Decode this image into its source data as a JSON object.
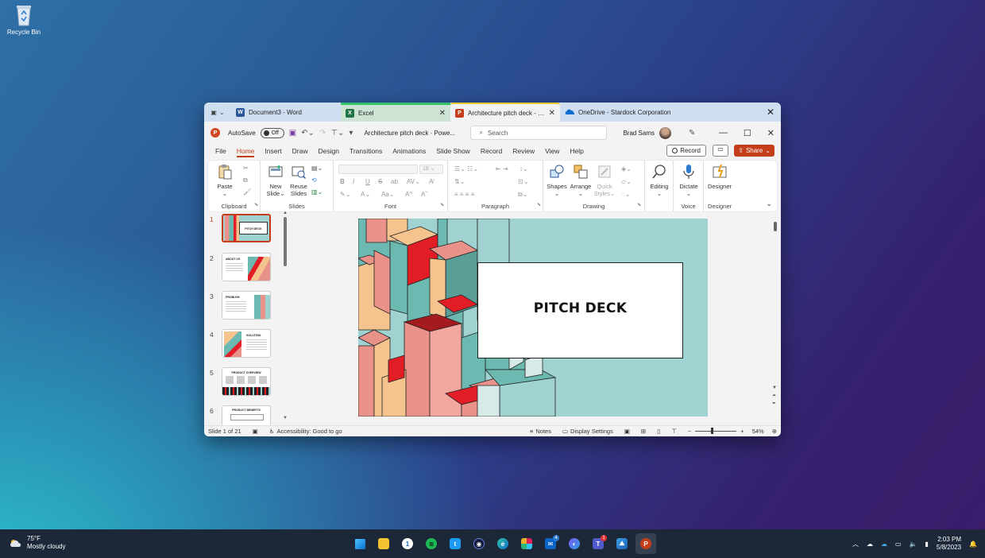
{
  "desktop": {
    "recycle_bin_label": "Recycle Bin"
  },
  "window": {
    "tabs": [
      {
        "label": "Document3 - Word",
        "app": "Word",
        "color": "#2b579a"
      },
      {
        "label": "Excel",
        "app": "Excel",
        "color": "#217346"
      },
      {
        "label": "Architecture pitch deck - P...",
        "app": "PowerPoint",
        "color": "#c43e1c"
      },
      {
        "label": "OneDrive - Stardock Corporation",
        "app": "OneDrive",
        "color": "#0078d4"
      }
    ],
    "title_bar": {
      "autosave_label": "AutoSave",
      "autosave_state": "Off",
      "doc_title": "Architecture pitch deck  ·  Powe...",
      "search_placeholder": "Search",
      "user_name": "Brad Sams"
    },
    "menu": [
      "File",
      "Home",
      "Insert",
      "Draw",
      "Design",
      "Transitions",
      "Animations",
      "Slide Show",
      "Record",
      "Review",
      "View",
      "Help"
    ],
    "active_menu": "Home",
    "record_label": "Record",
    "share_label": "Share",
    "ribbon": {
      "groups": {
        "clipboard": "Clipboard",
        "slides": "Slides",
        "font": "Font",
        "paragraph": "Paragraph",
        "drawing": "Drawing",
        "voice": "Voice",
        "designer": "Designer"
      },
      "buttons": {
        "paste": "Paste",
        "new_slide_1": "New",
        "new_slide_2": "Slide",
        "reuse_1": "Reuse",
        "reuse_2": "Slides",
        "shapes": "Shapes",
        "arrange": "Arrange",
        "quick_styles_1": "Quick",
        "quick_styles_2": "Styles",
        "editing": "Editing",
        "dictate": "Dictate",
        "designer": "Designer"
      },
      "font_size": "18"
    },
    "thumbnails": [
      {
        "num": "1",
        "title": "PITCH DECK"
      },
      {
        "num": "2",
        "title": "ABOUT US"
      },
      {
        "num": "3",
        "title": "PROBLEM"
      },
      {
        "num": "4",
        "title": "SOLUTION"
      },
      {
        "num": "5",
        "title": "PRODUCT OVERVIEW"
      },
      {
        "num": "6",
        "title": "PRODUCT BENEFITS"
      }
    ],
    "slide": {
      "title": "PITCH DECK"
    },
    "status": {
      "slide_info": "Slide 1 of 21",
      "accessibility": "Accessibility: Good to go",
      "notes": "Notes",
      "display_settings": "Display Settings",
      "zoom": "54%",
      "zoom_fraction": 0.54
    }
  },
  "taskbar": {
    "temperature": "75°F",
    "condition": "Mostly cloudy",
    "time": "2:03 PM",
    "date": "5/8/2023",
    "mail_badge": "4",
    "teams_badge": "1"
  },
  "colors": {
    "accent": "#c43e1c",
    "slide_bg": "#9fd2d0",
    "taskbar": "#1c2838"
  }
}
